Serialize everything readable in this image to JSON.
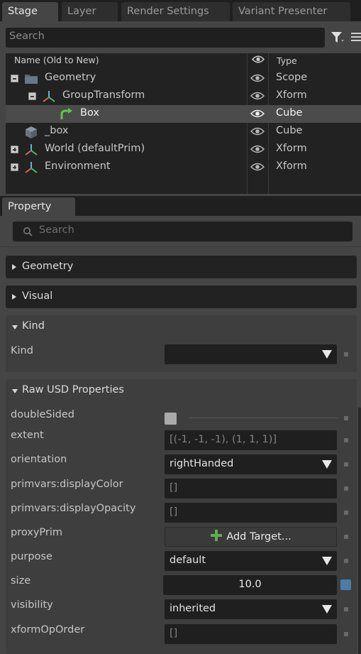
{
  "stage_tabs": [
    "Stage",
    "Layer",
    "Render Settings",
    "Variant Presenter"
  ],
  "stage": {
    "search_placeholder": "Search",
    "columns": {
      "name": "Name (Old to New)",
      "type": "Type"
    },
    "rows": [
      {
        "label": "Geometry",
        "type": "Scope",
        "icon": "folder-icon",
        "expander": "collapse",
        "selected": false
      },
      {
        "label": "GroupTransform",
        "type": "Xform",
        "icon": "xform-axes-icon",
        "expander": "collapse",
        "selected": false
      },
      {
        "label": "Box",
        "type": "Cube",
        "icon": "reference-arrow-icon",
        "expander": "none",
        "selected": true
      },
      {
        "label": "_box",
        "type": "Cube",
        "icon": "cube-icon",
        "expander": "none",
        "selected": false
      },
      {
        "label": "World (defaultPrim)",
        "type": "Xform",
        "icon": "xform-axes-icon",
        "expander": "expand",
        "selected": false
      },
      {
        "label": "Environment",
        "type": "Xform",
        "icon": "xform-axes-icon",
        "expander": "expand",
        "selected": false
      }
    ]
  },
  "property": {
    "tab": "Property",
    "search_placeholder": "Search",
    "sections": {
      "geometry": "Geometry",
      "visual": "Visual",
      "kind": "Kind",
      "raw": "Raw USD Properties"
    },
    "kind": {
      "label": "Kind",
      "value": ""
    },
    "raw": {
      "doubleSided": {
        "label": "doubleSided",
        "checked": false
      },
      "extent": {
        "label": "extent",
        "value": "[(-1, -1, -1), (1, 1, 1)]"
      },
      "orientation": {
        "label": "orientation",
        "value": "rightHanded"
      },
      "displayColor": {
        "label": "primvars:displayColor",
        "value": "[]"
      },
      "displayOpacity": {
        "label": "primvars:displayOpacity",
        "value": "[]"
      },
      "proxyPrim": {
        "label": "proxyPrim",
        "button": "Add Target..."
      },
      "purpose": {
        "label": "purpose",
        "value": "default"
      },
      "size": {
        "label": "size",
        "value": "10.0"
      },
      "visibility": {
        "label": "visibility",
        "value": "inherited"
      },
      "xformOpOrder": {
        "label": "xformOpOrder",
        "value": "[]"
      }
    }
  },
  "colors": {
    "panel": "#454545",
    "dark": "#1f1f1f",
    "selected_row": "#4b4b4b",
    "accent_blue": "#4a7ea6",
    "add_green": "#5fae4f"
  }
}
